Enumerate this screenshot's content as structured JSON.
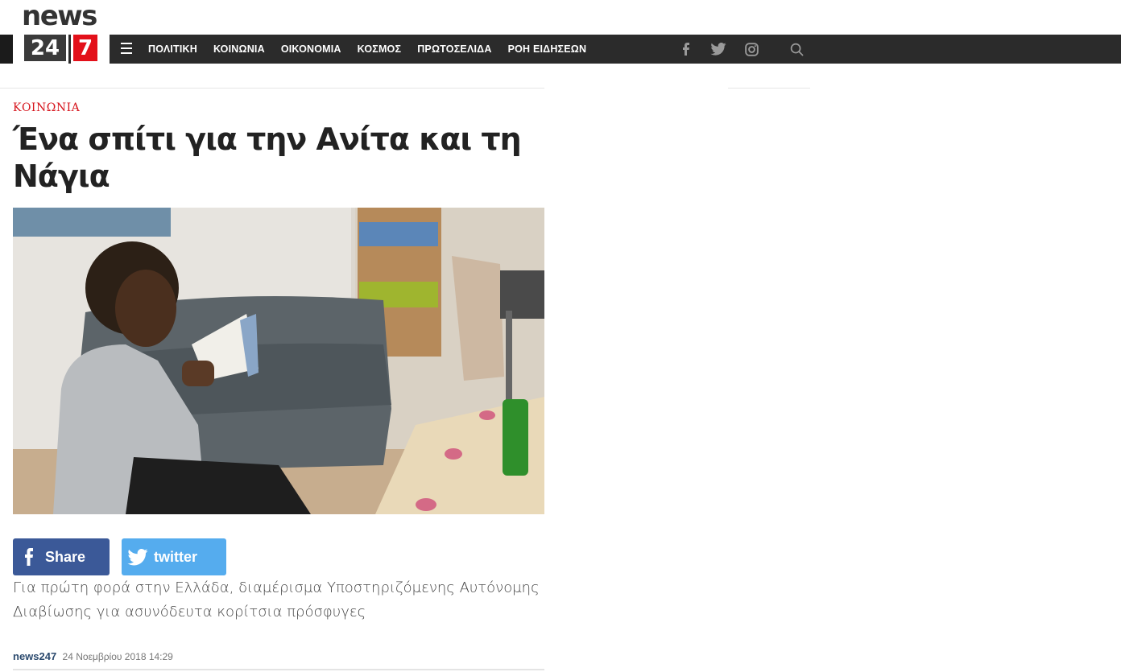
{
  "logo": {
    "top": "news",
    "num": "24",
    "seven": "7"
  },
  "nav": {
    "items": [
      "ΠΟΛΙΤΙΚΗ",
      "ΚΟΙΝΩΝΙΑ",
      "ΟΙΚΟΝΟΜΙΑ",
      "ΚΟΣΜΟΣ",
      "ΠΡΩΤΟΣΕΛΙΔΑ",
      "ΡΟΗ ΕΙΔΗΣΕΩΝ"
    ]
  },
  "article": {
    "category": "ΚΟΙΝΩΝΙΑ",
    "title": "Ένα σπίτι για την Ανίτα και τη Νάγια",
    "lead": "Για πρώτη φορά στην Ελλάδα, διαμέρισμα Υποστηριζόμενης Αυτόνομης Διαβίωσης για ασυνόδευτα κορίτσια πρόσφυγες",
    "author": "news247",
    "date": "24 Νοεμβρίου 2018 14:29"
  },
  "share": {
    "facebook": "Share",
    "twitter": "twitter"
  },
  "colors": {
    "accent": "#e3101a",
    "navbar": "#2b2b2b",
    "facebook": "#3b5998",
    "twitter": "#55acee"
  }
}
